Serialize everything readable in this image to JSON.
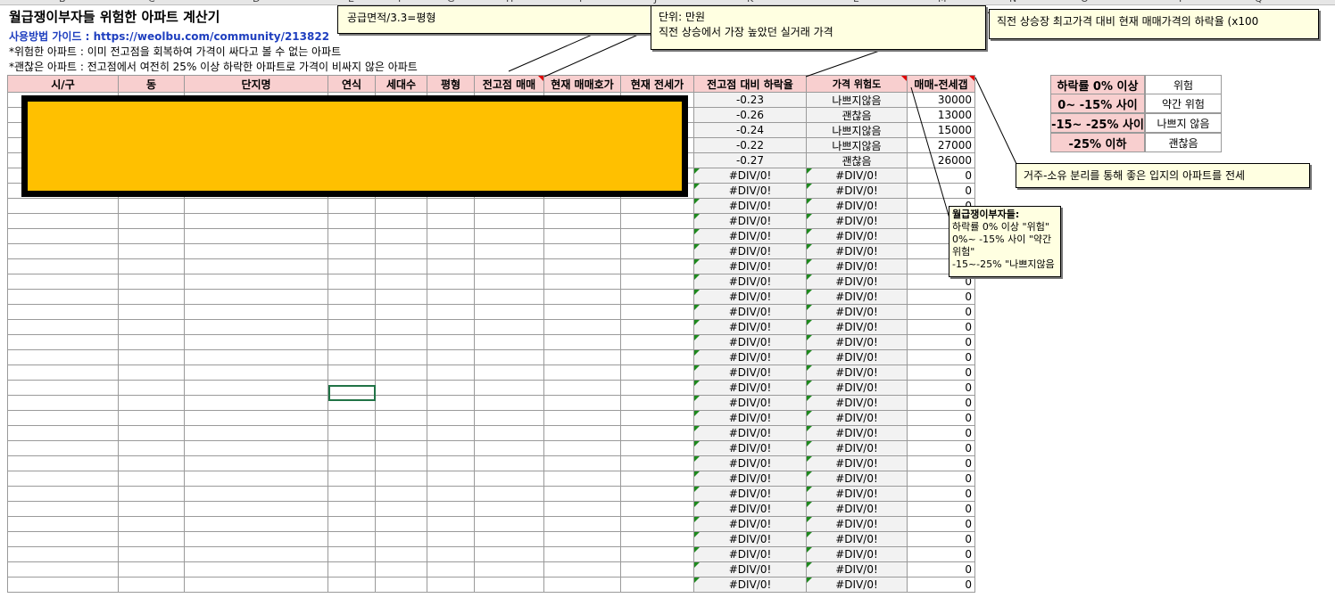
{
  "column_letters": [
    "B",
    "C",
    "D",
    "E",
    "F",
    "G",
    "H",
    "I",
    "J",
    "K",
    "L",
    "M",
    "N",
    "O",
    "P",
    "Q"
  ],
  "title": "월급쟁이부자들 위험한 아파트 계산기",
  "guide": "사용방법 가이드 : https://weolbu.com/community/213822",
  "note_risky": "*위험한 아파트 : 이미 전고점을 회복하여 가격이 싸다고 볼 수 없는 아파트",
  "note_good": "*괜찮은 아파트 : 전고점에서 여전히 25% 이상 하락한 아파트로 가격이 비싸지 않은 아파트",
  "headers": [
    "시/구",
    "동",
    "단지명",
    "연식",
    "세대수",
    "평형",
    "전고점 매매",
    "현재 매매호가",
    "현재 전세가",
    "전고점 대비 하락율",
    "가격 위험도",
    "매매-전세갭"
  ],
  "rows": [
    {
      "rate": "-0.23",
      "risk": "나쁘지않음",
      "gap": "30000"
    },
    {
      "rate": "-0.26",
      "risk": "괜찮음",
      "gap": "13000"
    },
    {
      "rate": "-0.24",
      "risk": "나쁘지않음",
      "gap": "15000"
    },
    {
      "rate": "-0.22",
      "risk": "나쁘지않음",
      "gap": "27000"
    },
    {
      "rate": "-0.27",
      "risk": "괜찮음",
      "gap": "26000"
    },
    {
      "rate": "#DIV/0!",
      "risk": "#DIV/0!",
      "gap": "0"
    },
    {
      "rate": "#DIV/0!",
      "risk": "#DIV/0!",
      "gap": "0"
    },
    {
      "rate": "#DIV/0!",
      "risk": "#DIV/0!",
      "gap": "0"
    },
    {
      "rate": "#DIV/0!",
      "risk": "#DIV/0!",
      "gap": "0"
    },
    {
      "rate": "#DIV/0!",
      "risk": "#DIV/0!",
      "gap": "0"
    },
    {
      "rate": "#DIV/0!",
      "risk": "#DIV/0!",
      "gap": "0"
    },
    {
      "rate": "#DIV/0!",
      "risk": "#DIV/0!",
      "gap": "0"
    },
    {
      "rate": "#DIV/0!",
      "risk": "#DIV/0!",
      "gap": "0"
    },
    {
      "rate": "#DIV/0!",
      "risk": "#DIV/0!",
      "gap": "0"
    },
    {
      "rate": "#DIV/0!",
      "risk": "#DIV/0!",
      "gap": "0"
    },
    {
      "rate": "#DIV/0!",
      "risk": "#DIV/0!",
      "gap": "0"
    },
    {
      "rate": "#DIV/0!",
      "risk": "#DIV/0!",
      "gap": "0"
    },
    {
      "rate": "#DIV/0!",
      "risk": "#DIV/0!",
      "gap": "0"
    },
    {
      "rate": "#DIV/0!",
      "risk": "#DIV/0!",
      "gap": "0"
    },
    {
      "rate": "#DIV/0!",
      "risk": "#DIV/0!",
      "gap": "0"
    },
    {
      "rate": "#DIV/0!",
      "risk": "#DIV/0!",
      "gap": "0"
    },
    {
      "rate": "#DIV/0!",
      "risk": "#DIV/0!",
      "gap": "0"
    },
    {
      "rate": "#DIV/0!",
      "risk": "#DIV/0!",
      "gap": "0"
    },
    {
      "rate": "#DIV/0!",
      "risk": "#DIV/0!",
      "gap": "0"
    },
    {
      "rate": "#DIV/0!",
      "risk": "#DIV/0!",
      "gap": "0"
    },
    {
      "rate": "#DIV/0!",
      "risk": "#DIV/0!",
      "gap": "0"
    },
    {
      "rate": "#DIV/0!",
      "risk": "#DIV/0!",
      "gap": "0"
    },
    {
      "rate": "#DIV/0!",
      "risk": "#DIV/0!",
      "gap": "0"
    },
    {
      "rate": "#DIV/0!",
      "risk": "#DIV/0!",
      "gap": "0"
    },
    {
      "rate": "#DIV/0!",
      "risk": "#DIV/0!",
      "gap": "0"
    },
    {
      "rate": "#DIV/0!",
      "risk": "#DIV/0!",
      "gap": "0"
    },
    {
      "rate": "#DIV/0!",
      "risk": "#DIV/0!",
      "gap": "0"
    },
    {
      "rate": "#DIV/0!",
      "risk": "#DIV/0!",
      "gap": "0"
    }
  ],
  "legend": [
    {
      "range": "하락률 0% 이상",
      "label": "위험"
    },
    {
      "range": "0~ -15% 사이",
      "label": "약간 위험"
    },
    {
      "range": "-15~ -25% 사이",
      "label": "나쁘지 않음"
    },
    {
      "range": "-25% 이하",
      "label": "괜찮음"
    }
  ],
  "comments": {
    "area": "공급면적/3.3=평형",
    "unit_line1": "단위: 만원",
    "unit_line2": "직전 상승에서 가장 높았던 실거래 가격",
    "decline": "직전 상승장 최고가격 대비 현재 매매가격의 하락율 (x100",
    "gap": "거주-소유 분리를 통해 좋은 입지의 아파트를 전세",
    "risk_title": "월급쟁이부자들:",
    "risk_line1": "하락률 0% 이상 \"위험\"",
    "risk_line2": "0%~ -15% 사이 \"약간",
    "risk_line3": "위험\"",
    "risk_line4": "-15~-25% \"나쁘지않음"
  }
}
